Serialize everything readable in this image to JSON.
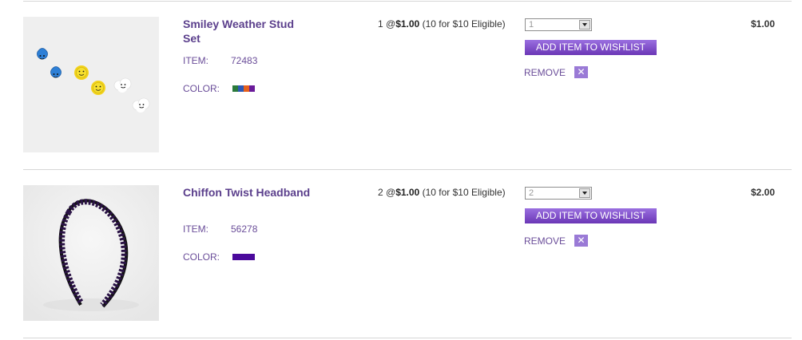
{
  "cart": {
    "items": [
      {
        "name": "Smiley Weather Stud Set",
        "item_label": "ITEM:",
        "item_number": "72483",
        "color_label": "COLOR:",
        "color_swatches": [
          "#2a7a3c",
          "#2c58b6",
          "#e5601c",
          "#6a1b9a"
        ],
        "price_qty": "1 @",
        "price_value": "$1.00",
        "price_note": "(10 for $10 Eligible)",
        "quantity_value": "1",
        "wishlist_label": "ADD ITEM TO WISHLIST",
        "remove_label": "REMOVE",
        "remove_icon": "close-icon",
        "total": "$1.00"
      },
      {
        "name": "Chiffon Twist Headband",
        "item_label": "ITEM:",
        "item_number": "56278",
        "color_label": "COLOR:",
        "color_swatches": [
          "#4b0a9c"
        ],
        "price_qty": "2 @",
        "price_value": "$1.00",
        "price_note": "(10 for $10 Eligible)",
        "quantity_value": "2",
        "wishlist_label": "ADD ITEM TO WISHLIST",
        "remove_label": "REMOVE",
        "remove_icon": "close-icon",
        "total": "$2.00"
      }
    ]
  },
  "colors": {
    "accent": "#6a4d99",
    "button": "#7b4bc6"
  }
}
